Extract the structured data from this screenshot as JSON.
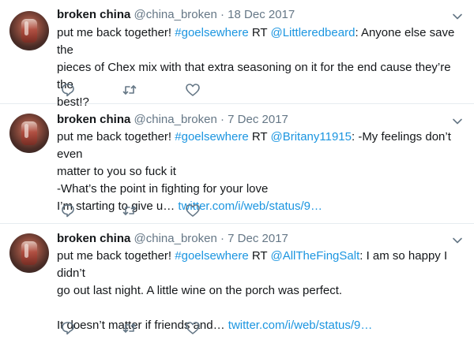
{
  "tweets": [
    {
      "name": "broken china",
      "handle": "@china_broken",
      "separator": "·",
      "date": "18 Dec 2017",
      "lines": [
        [
          {
            "t": "put me back together! ",
            "k": "text"
          },
          {
            "t": "#goelsewhere",
            "k": "link"
          },
          {
            "t": " RT ",
            "k": "text"
          },
          {
            "t": "@Littleredbeard",
            "k": "link"
          },
          {
            "t": ": Anyone else save the",
            "k": "text"
          }
        ],
        [
          {
            "t": "pieces of Chex mix with that extra seasoning on it for the end cause they’re the",
            "k": "text"
          }
        ],
        [
          {
            "t": "best!?",
            "k": "text"
          }
        ]
      ]
    },
    {
      "name": "broken china",
      "handle": "@china_broken",
      "separator": "·",
      "date": "7 Dec 2017",
      "lines": [
        [
          {
            "t": "put me back together! ",
            "k": "text"
          },
          {
            "t": "#goelsewhere",
            "k": "link"
          },
          {
            "t": " RT ",
            "k": "text"
          },
          {
            "t": "@Britany11915",
            "k": "link"
          },
          {
            "t": ": -My feelings don’t even",
            "k": "text"
          }
        ],
        [
          {
            "t": "matter to you so fuck it",
            "k": "text"
          }
        ],
        [
          {
            "t": "-What’s the point in fighting for your love",
            "k": "text"
          }
        ],
        [
          {
            "t": "I’m starting to give u… ",
            "k": "text"
          },
          {
            "t": "twitter.com/i/web/status/9…",
            "k": "link"
          }
        ]
      ]
    },
    {
      "name": "broken china",
      "handle": "@china_broken",
      "separator": "·",
      "date": "7 Dec 2017",
      "lines": [
        [
          {
            "t": "put me back together! ",
            "k": "text"
          },
          {
            "t": "#goelsewhere",
            "k": "link"
          },
          {
            "t": " RT ",
            "k": "text"
          },
          {
            "t": "@AllTheFingSalt",
            "k": "link"
          },
          {
            "t": ": I am so happy I didn’t",
            "k": "text"
          }
        ],
        [
          {
            "t": "go out last night. A little wine on the porch was perfect.",
            "k": "text"
          }
        ],
        [
          {
            "t": "",
            "k": "text"
          }
        ],
        [
          {
            "t": "It doesn’t matter if friends and… ",
            "k": "text"
          },
          {
            "t": "twitter.com/i/web/status/9…",
            "k": "link"
          }
        ]
      ]
    }
  ],
  "icons": {
    "menu": "chevron-down-icon",
    "reply": "reply-icon",
    "retweet": "retweet-icon",
    "like": "heart-icon"
  },
  "colors": {
    "text": "#14171a",
    "muted": "#657786",
    "link": "#1b95e0",
    "icon": "#657786",
    "divider": "#e6ecf0"
  }
}
